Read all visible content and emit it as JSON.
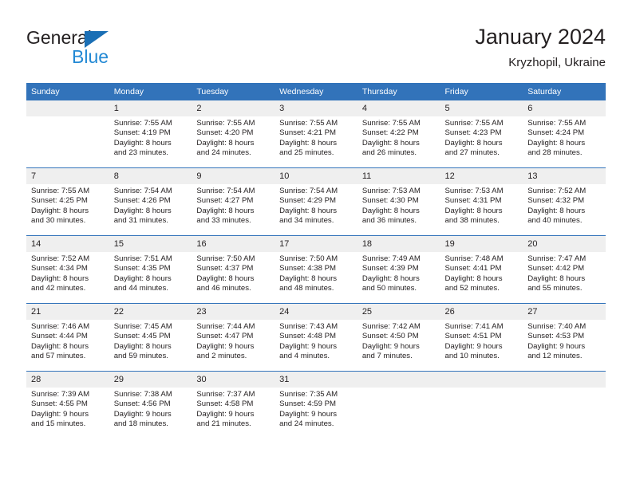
{
  "brand": {
    "name_part1": "General",
    "name_part2": "Blue",
    "logo_icon": "triangle-flag-icon",
    "accent_color": "#2389d4",
    "triangle_color": "#1a6fb5"
  },
  "header": {
    "title": "January 2024",
    "subtitle": "Kryzhopil, Ukraine"
  },
  "calendar": {
    "header_bg": "#3273ba",
    "daynum_bg": "#efefef",
    "weekday_headers": [
      "Sunday",
      "Monday",
      "Tuesday",
      "Wednesday",
      "Thursday",
      "Friday",
      "Saturday"
    ],
    "weeks": [
      [
        {
          "day": "",
          "lines": []
        },
        {
          "day": "1",
          "lines": [
            "Sunrise: 7:55 AM",
            "Sunset: 4:19 PM",
            "Daylight: 8 hours",
            "and 23 minutes."
          ]
        },
        {
          "day": "2",
          "lines": [
            "Sunrise: 7:55 AM",
            "Sunset: 4:20 PM",
            "Daylight: 8 hours",
            "and 24 minutes."
          ]
        },
        {
          "day": "3",
          "lines": [
            "Sunrise: 7:55 AM",
            "Sunset: 4:21 PM",
            "Daylight: 8 hours",
            "and 25 minutes."
          ]
        },
        {
          "day": "4",
          "lines": [
            "Sunrise: 7:55 AM",
            "Sunset: 4:22 PM",
            "Daylight: 8 hours",
            "and 26 minutes."
          ]
        },
        {
          "day": "5",
          "lines": [
            "Sunrise: 7:55 AM",
            "Sunset: 4:23 PM",
            "Daylight: 8 hours",
            "and 27 minutes."
          ]
        },
        {
          "day": "6",
          "lines": [
            "Sunrise: 7:55 AM",
            "Sunset: 4:24 PM",
            "Daylight: 8 hours",
            "and 28 minutes."
          ]
        }
      ],
      [
        {
          "day": "7",
          "lines": [
            "Sunrise: 7:55 AM",
            "Sunset: 4:25 PM",
            "Daylight: 8 hours",
            "and 30 minutes."
          ]
        },
        {
          "day": "8",
          "lines": [
            "Sunrise: 7:54 AM",
            "Sunset: 4:26 PM",
            "Daylight: 8 hours",
            "and 31 minutes."
          ]
        },
        {
          "day": "9",
          "lines": [
            "Sunrise: 7:54 AM",
            "Sunset: 4:27 PM",
            "Daylight: 8 hours",
            "and 33 minutes."
          ]
        },
        {
          "day": "10",
          "lines": [
            "Sunrise: 7:54 AM",
            "Sunset: 4:29 PM",
            "Daylight: 8 hours",
            "and 34 minutes."
          ]
        },
        {
          "day": "11",
          "lines": [
            "Sunrise: 7:53 AM",
            "Sunset: 4:30 PM",
            "Daylight: 8 hours",
            "and 36 minutes."
          ]
        },
        {
          "day": "12",
          "lines": [
            "Sunrise: 7:53 AM",
            "Sunset: 4:31 PM",
            "Daylight: 8 hours",
            "and 38 minutes."
          ]
        },
        {
          "day": "13",
          "lines": [
            "Sunrise: 7:52 AM",
            "Sunset: 4:32 PM",
            "Daylight: 8 hours",
            "and 40 minutes."
          ]
        }
      ],
      [
        {
          "day": "14",
          "lines": [
            "Sunrise: 7:52 AM",
            "Sunset: 4:34 PM",
            "Daylight: 8 hours",
            "and 42 minutes."
          ]
        },
        {
          "day": "15",
          "lines": [
            "Sunrise: 7:51 AM",
            "Sunset: 4:35 PM",
            "Daylight: 8 hours",
            "and 44 minutes."
          ]
        },
        {
          "day": "16",
          "lines": [
            "Sunrise: 7:50 AM",
            "Sunset: 4:37 PM",
            "Daylight: 8 hours",
            "and 46 minutes."
          ]
        },
        {
          "day": "17",
          "lines": [
            "Sunrise: 7:50 AM",
            "Sunset: 4:38 PM",
            "Daylight: 8 hours",
            "and 48 minutes."
          ]
        },
        {
          "day": "18",
          "lines": [
            "Sunrise: 7:49 AM",
            "Sunset: 4:39 PM",
            "Daylight: 8 hours",
            "and 50 minutes."
          ]
        },
        {
          "day": "19",
          "lines": [
            "Sunrise: 7:48 AM",
            "Sunset: 4:41 PM",
            "Daylight: 8 hours",
            "and 52 minutes."
          ]
        },
        {
          "day": "20",
          "lines": [
            "Sunrise: 7:47 AM",
            "Sunset: 4:42 PM",
            "Daylight: 8 hours",
            "and 55 minutes."
          ]
        }
      ],
      [
        {
          "day": "21",
          "lines": [
            "Sunrise: 7:46 AM",
            "Sunset: 4:44 PM",
            "Daylight: 8 hours",
            "and 57 minutes."
          ]
        },
        {
          "day": "22",
          "lines": [
            "Sunrise: 7:45 AM",
            "Sunset: 4:45 PM",
            "Daylight: 8 hours",
            "and 59 minutes."
          ]
        },
        {
          "day": "23",
          "lines": [
            "Sunrise: 7:44 AM",
            "Sunset: 4:47 PM",
            "Daylight: 9 hours",
            "and 2 minutes."
          ]
        },
        {
          "day": "24",
          "lines": [
            "Sunrise: 7:43 AM",
            "Sunset: 4:48 PM",
            "Daylight: 9 hours",
            "and 4 minutes."
          ]
        },
        {
          "day": "25",
          "lines": [
            "Sunrise: 7:42 AM",
            "Sunset: 4:50 PM",
            "Daylight: 9 hours",
            "and 7 minutes."
          ]
        },
        {
          "day": "26",
          "lines": [
            "Sunrise: 7:41 AM",
            "Sunset: 4:51 PM",
            "Daylight: 9 hours",
            "and 10 minutes."
          ]
        },
        {
          "day": "27",
          "lines": [
            "Sunrise: 7:40 AM",
            "Sunset: 4:53 PM",
            "Daylight: 9 hours",
            "and 12 minutes."
          ]
        }
      ],
      [
        {
          "day": "28",
          "lines": [
            "Sunrise: 7:39 AM",
            "Sunset: 4:55 PM",
            "Daylight: 9 hours",
            "and 15 minutes."
          ]
        },
        {
          "day": "29",
          "lines": [
            "Sunrise: 7:38 AM",
            "Sunset: 4:56 PM",
            "Daylight: 9 hours",
            "and 18 minutes."
          ]
        },
        {
          "day": "30",
          "lines": [
            "Sunrise: 7:37 AM",
            "Sunset: 4:58 PM",
            "Daylight: 9 hours",
            "and 21 minutes."
          ]
        },
        {
          "day": "31",
          "lines": [
            "Sunrise: 7:35 AM",
            "Sunset: 4:59 PM",
            "Daylight: 9 hours",
            "and 24 minutes."
          ]
        },
        {
          "day": "",
          "lines": []
        },
        {
          "day": "",
          "lines": []
        },
        {
          "day": "",
          "lines": []
        }
      ]
    ]
  }
}
